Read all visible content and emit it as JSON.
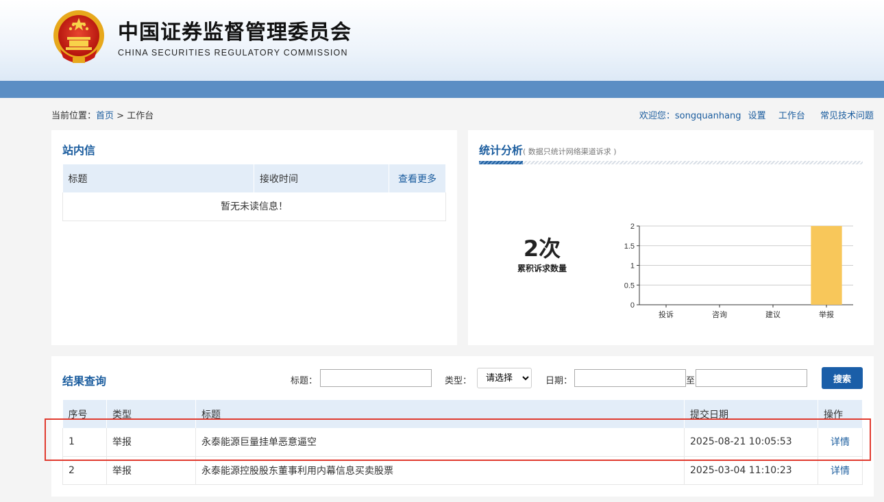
{
  "header": {
    "title": "中国证券监督管理委员会",
    "subtitle": "CHINA SECURITIES REGULATORY COMMISSION"
  },
  "breadcrumb": {
    "prefix": "当前位置：",
    "home": "首页",
    "sep": ">",
    "current": "工作台"
  },
  "topnav": {
    "welcome": "欢迎您：songquanhang",
    "settings": "设置",
    "workbench": "工作台",
    "faq": "常见技术问题"
  },
  "inbox": {
    "title": "站内信",
    "col_title": "标题",
    "col_time": "接收时间",
    "more": "查看更多",
    "empty": "暂无未读信息！"
  },
  "stats": {
    "title": "统计分析",
    "note": "( 数据只统计网络渠道诉求 )",
    "total": "2次",
    "total_label": "累积诉求数量"
  },
  "chart_data": {
    "type": "bar",
    "categories": [
      "投诉",
      "咨询",
      "建议",
      "举报"
    ],
    "values": [
      0,
      0,
      0,
      2
    ],
    "ylim": [
      0,
      2
    ],
    "yticks": [
      "0",
      "0.5",
      "1",
      "1.5",
      "2"
    ],
    "grid": true,
    "bar_color": "#f8c75a"
  },
  "results": {
    "title": "结果查询",
    "filter_title_label": "标题：",
    "filter_type_label": "类型：",
    "filter_type_value": "请选择",
    "filter_date_label": "日期：",
    "filter_date_to": "至",
    "search_button": "搜索",
    "columns": [
      "序号",
      "类型",
      "标题",
      "提交日期",
      "操作"
    ],
    "rows": [
      {
        "no": "1",
        "type": "举报",
        "title": "永泰能源巨量挂单恶意逼空",
        "date": "2025-08-21 10:05:53",
        "action": "详情"
      },
      {
        "no": "2",
        "type": "举报",
        "title": "永泰能源控股股东董事利用内幕信息买卖股票",
        "date": "2025-03-04 11:10:23",
        "action": "详情"
      }
    ]
  },
  "colors": {
    "accent": "#1a5c9e",
    "header_bar": "#5b8ec4",
    "highlight": "#e03a2e"
  }
}
